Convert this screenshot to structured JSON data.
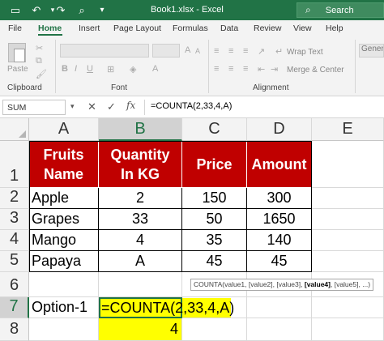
{
  "titlebar": {
    "title": "Book1.xlsx  -  Excel",
    "search_label": "Search",
    "colors": {
      "excel_green": "#217346"
    }
  },
  "tabs": [
    {
      "label": "File",
      "active": false
    },
    {
      "label": "Home",
      "active": true
    },
    {
      "label": "Insert",
      "active": false
    },
    {
      "label": "Page Layout",
      "active": false
    },
    {
      "label": "Formulas",
      "active": false
    },
    {
      "label": "Data",
      "active": false
    },
    {
      "label": "Review",
      "active": false
    },
    {
      "label": "View",
      "active": false
    },
    {
      "label": "Help",
      "active": false
    }
  ],
  "ribbon": {
    "paste_label": "Paste",
    "clipboard_label": "Clipboard",
    "font_label": "Font",
    "alignment_label": "Alignment",
    "wrap_text_label": "Wrap Text",
    "merge_center_label": "Merge & Center",
    "number_format": "General"
  },
  "formula_bar": {
    "name_box": "SUM",
    "cancel_icon": "✕",
    "enter_icon": "✓",
    "fx_label": "fx",
    "formula": "=COUNTA(2,33,4,A)"
  },
  "columns": [
    "A",
    "B",
    "C",
    "D",
    "E"
  ],
  "rows": [
    "1",
    "2",
    "3",
    "4",
    "5",
    "6",
    "7",
    "8"
  ],
  "table": {
    "headers": [
      {
        "line1": "Fruits",
        "line2": "Name"
      },
      {
        "line1": "Quantity",
        "line2": "In KG"
      },
      {
        "line1": "Price",
        "line2": ""
      },
      {
        "line1": "Amount",
        "line2": ""
      }
    ],
    "data": [
      [
        "Apple",
        "2",
        "150",
        "300"
      ],
      [
        "Grapes",
        "33",
        "50",
        "1650"
      ],
      [
        "Mango",
        "4",
        "35",
        "140"
      ],
      [
        "Papaya",
        "A",
        "45",
        "45"
      ]
    ],
    "colors": {
      "header_bg": "#c00000",
      "highlight": "#ffff00"
    }
  },
  "option_label": "Option-1",
  "edit_formula": "=COUNTA(2,33,4,A)",
  "result_value": "4",
  "tooltip": {
    "pre": "COUNTA(value1, [value2], [value3], ",
    "bold": "[value4]",
    "post": ", [value5], ...)"
  }
}
